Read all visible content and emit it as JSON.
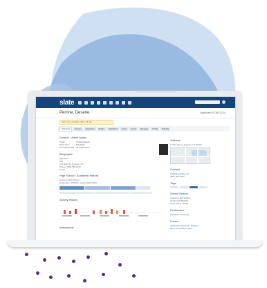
{
  "screen": {
    "logo": "slate",
    "topbar_note": "",
    "person_name": "Perrine, Deserie",
    "application_id": "Applicant  STAR1234",
    "alert": "Alert: Your deadline date is 8 Jan.",
    "tabs": [
      "Dashboard",
      "Timeline",
      "Interactions",
      "Reader",
      "Applications",
      "Forms",
      "Events",
      "Messages",
      "Portals",
      "Materials"
    ],
    "left": {
      "section1_title": "Deserie  -  Admit status",
      "kv": [
        [
          "Origin",
          "Undergraduate"
        ],
        [
          "Entry Term",
          "Fall 2023"
        ],
        [
          "ACT Composite",
          "33  superscore"
        ]
      ],
      "bio_title": "Biographic",
      "bio_lines": [
        "Birthdate",
        "Sex",
        "123 Main St, Anytown, NJ",
        "Phone: (555) 555 0123",
        "Email"
      ],
      "section2_title": "High School · Academic History",
      "section2_lines": [
        "Anytown High School",
        "Graduation: 05/2023, Applied 2021/2022"
      ],
      "section3_title": "Activity History",
      "section4_title": "Interactions"
    },
    "right": {
      "map_title": "Address",
      "map_caption": "1 Main Street, Anytown, NJ 00000",
      "contact_title": "Contact",
      "contact_lines": [
        "email@example.com",
        "(555) 555-0123"
      ],
      "tags_title": "Tags",
      "school_title": "School History",
      "school_lines": [
        "Anytown High School",
        "Graduated 05/2023",
        "Class Rank: 12/300"
      ],
      "dest_title": "Destination",
      "dest_lines": [
        "Wesleyan University"
      ],
      "forms_title": "Forms",
      "form_lines": [
        "Application Payment · Sample",
        "Recommendation Letter"
      ]
    }
  },
  "colors": {
    "blob_main": "#8fb4de",
    "blob_light": "#cfe0f3",
    "dots": "#5b2a86",
    "topbar": "#14447a"
  }
}
